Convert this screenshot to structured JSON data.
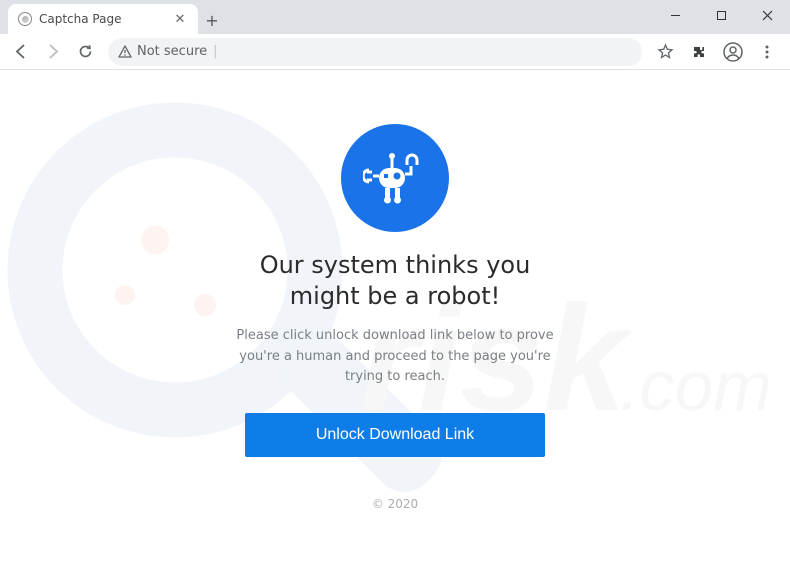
{
  "browser": {
    "tab_title": "Captcha Page",
    "security_label": "Not secure",
    "url_display": ""
  },
  "page": {
    "headline": "Our system thinks you might be a robot!",
    "subtext": "Please click unlock download link below to prove you're a human and proceed to the page you're trying to reach.",
    "cta_label": "Unlock Download Link",
    "footer": "© 2020"
  },
  "watermark": {
    "text": "pcrisk.com"
  }
}
